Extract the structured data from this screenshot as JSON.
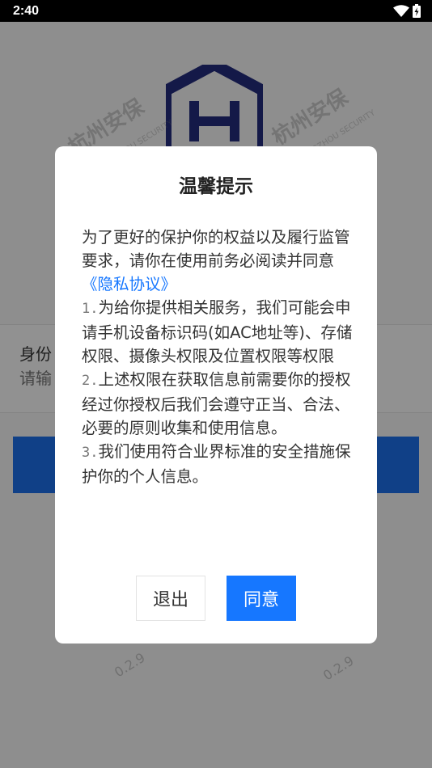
{
  "status_bar": {
    "time": "2:40",
    "icons": [
      "wifi-icon",
      "battery-charging-icon"
    ]
  },
  "background_app": {
    "logo": "company-logo-icon",
    "watermark_text": "杭州安保",
    "watermark_sub": "HANGZHOU SECURITY",
    "watermark_version": "0.2.9",
    "field_label": "身份",
    "field_placeholder": "请输"
  },
  "dialog": {
    "title": "温馨提示",
    "intro": "为了更好的保护你的权益以及履行监管要求，请你在使用前务必阅读并同意",
    "privacy_link": "《隐私协议》",
    "items": [
      {
        "num": "1.",
        "text": "为给你提供相关服务，我们可能会申请手机设备标识码(如AC地址等)、存储权限、摄像头权限及位置权限等权限"
      },
      {
        "num": "2.",
        "text": "上述权限在获取信息前需要你的授权经过你授权后我们会遵守正当、合法、必要的原则收集和使用信息。"
      },
      {
        "num": "3.",
        "text": "我们使用符合业界标准的安全措施保护你的个人信息。"
      }
    ],
    "exit_label": "退出",
    "agree_label": "同意"
  },
  "colors": {
    "accent": "#1677ff",
    "overlay": "rgba(0,0,0,0.42)",
    "logo": "#232c7c"
  }
}
